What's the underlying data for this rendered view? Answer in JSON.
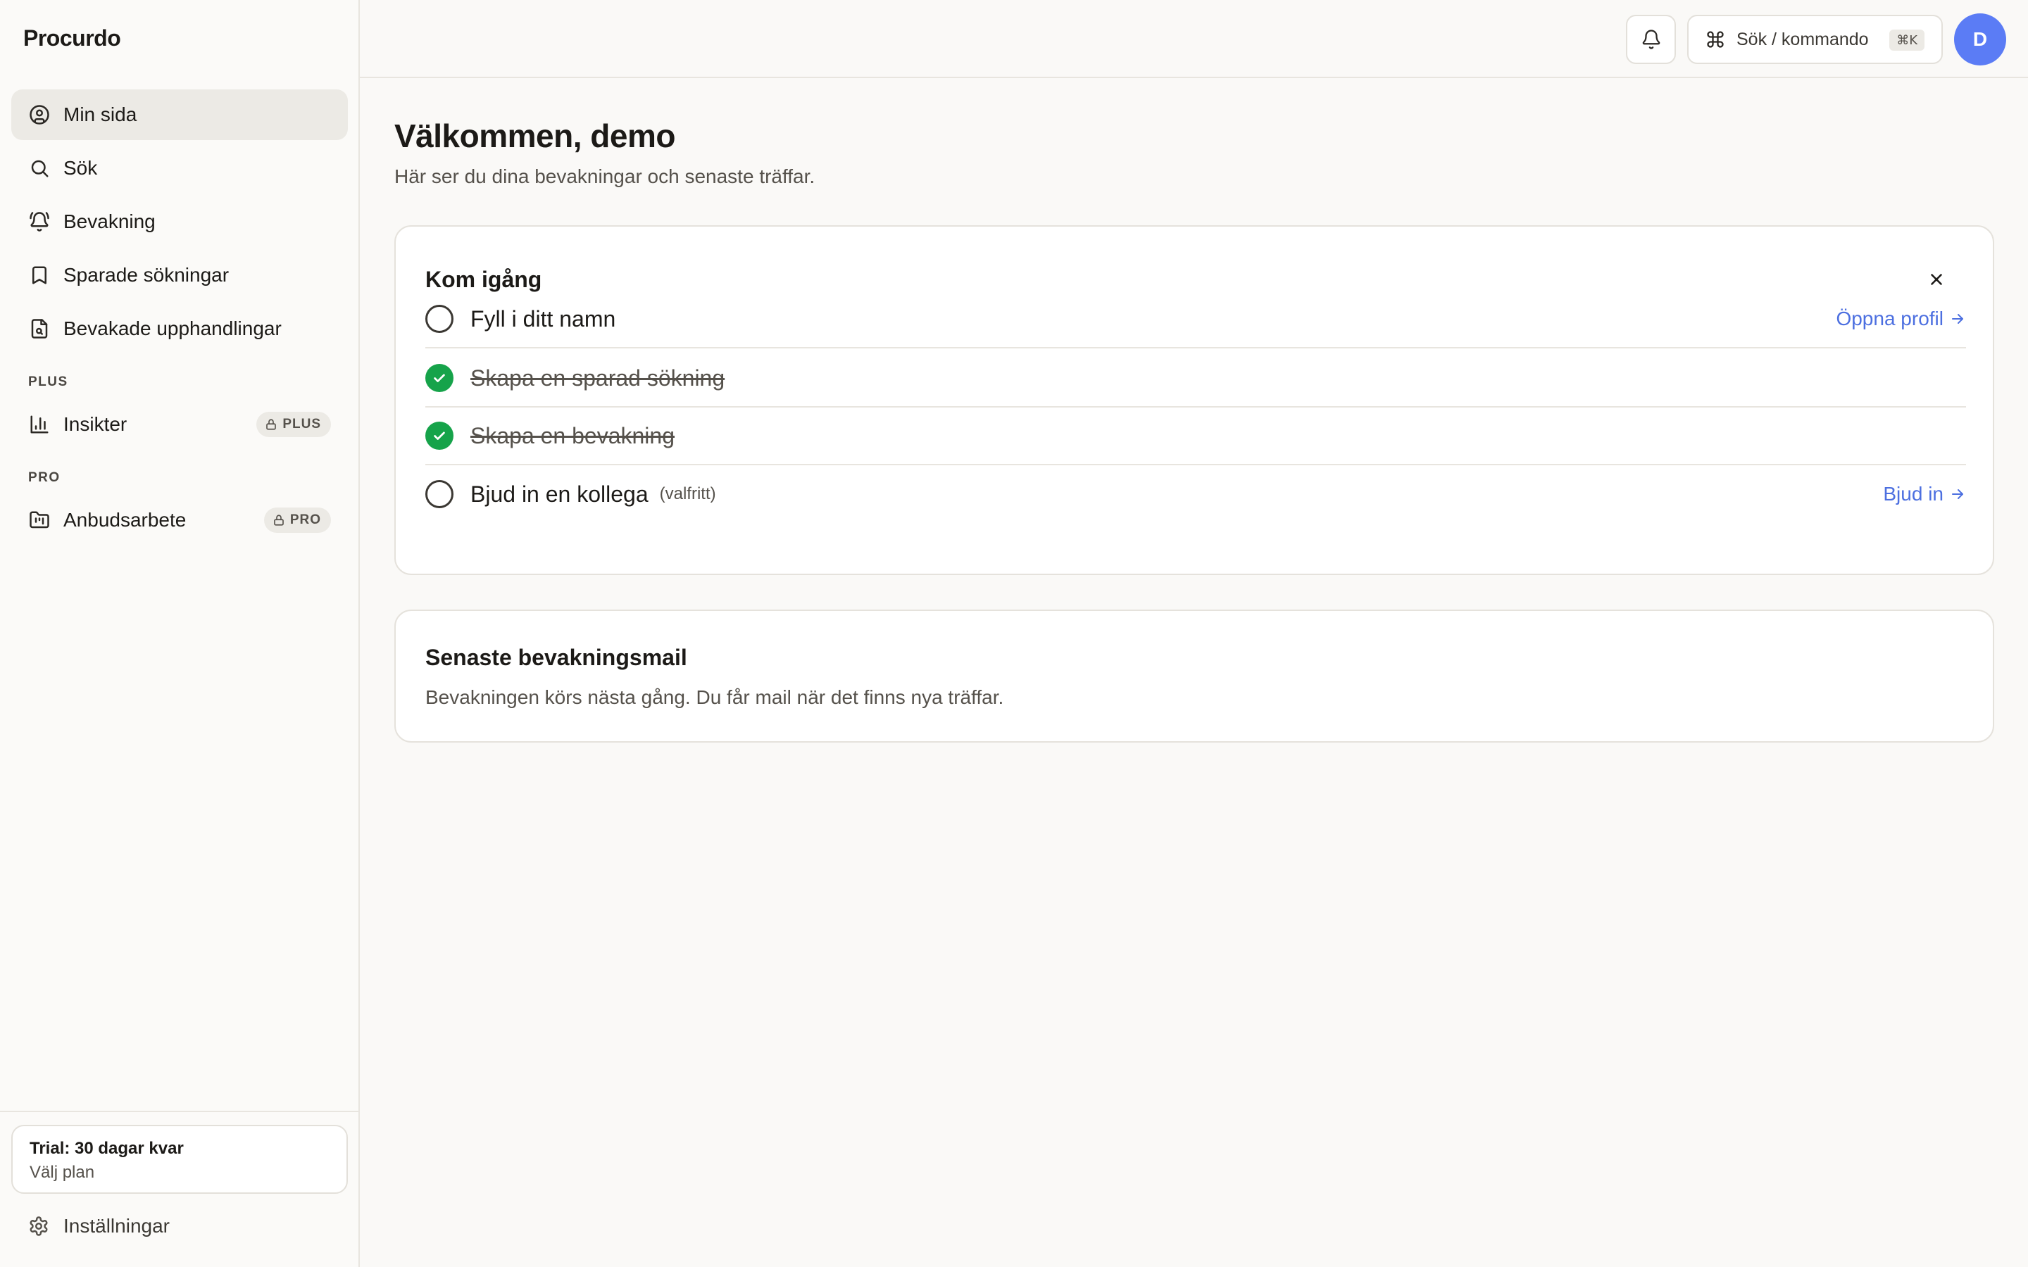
{
  "app": {
    "name": "Procurdo"
  },
  "sidebar": {
    "items": [
      {
        "label": "Min sida",
        "icon": "user-circle-icon",
        "active": true
      },
      {
        "label": "Sök",
        "icon": "search-icon"
      },
      {
        "label": "Bevakning",
        "icon": "bell-ring-icon"
      },
      {
        "label": "Sparade sökningar",
        "icon": "bookmark-icon"
      },
      {
        "label": "Bevakade upphandlingar",
        "icon": "file-search-icon"
      }
    ],
    "plus_section": {
      "label": "PLUS",
      "items": [
        {
          "label": "Insikter",
          "icon": "bar-chart-icon",
          "badge": "PLUS"
        }
      ]
    },
    "pro_section": {
      "label": "PRO",
      "items": [
        {
          "label": "Anbudsarbete",
          "icon": "folder-kanban-icon",
          "badge": "PRO"
        }
      ]
    },
    "trial": {
      "title": "Trial: 30 dagar kvar",
      "action": "Välj plan"
    },
    "settings_label": "Inställningar"
  },
  "topbar": {
    "search_label": "Sök / kommando",
    "shortcut": "⌘K",
    "avatar_initial": "D"
  },
  "main": {
    "title": "Välkommen, demo",
    "subtitle": "Här ser du dina bevakningar och senaste träffar.",
    "get_started": {
      "title": "Kom igång",
      "tasks": [
        {
          "label": "Fyll i ditt namn",
          "done": false,
          "link": "Öppna profil"
        },
        {
          "label": "Skapa en sparad sökning",
          "done": true
        },
        {
          "label": "Skapa en bevakning",
          "done": true
        },
        {
          "label": "Bjud in en kollega",
          "note": "(valfritt)",
          "done": false,
          "link": "Bjud in"
        }
      ]
    },
    "latest_mail": {
      "title": "Senaste bevakningsmail",
      "text": "Bevakningen körs nästa gång. Du får mail när det finns nya träffar."
    }
  },
  "colors": {
    "accent_link": "#4c6fe0",
    "avatar": "#5b7cf5",
    "done_check": "#16a34a"
  }
}
